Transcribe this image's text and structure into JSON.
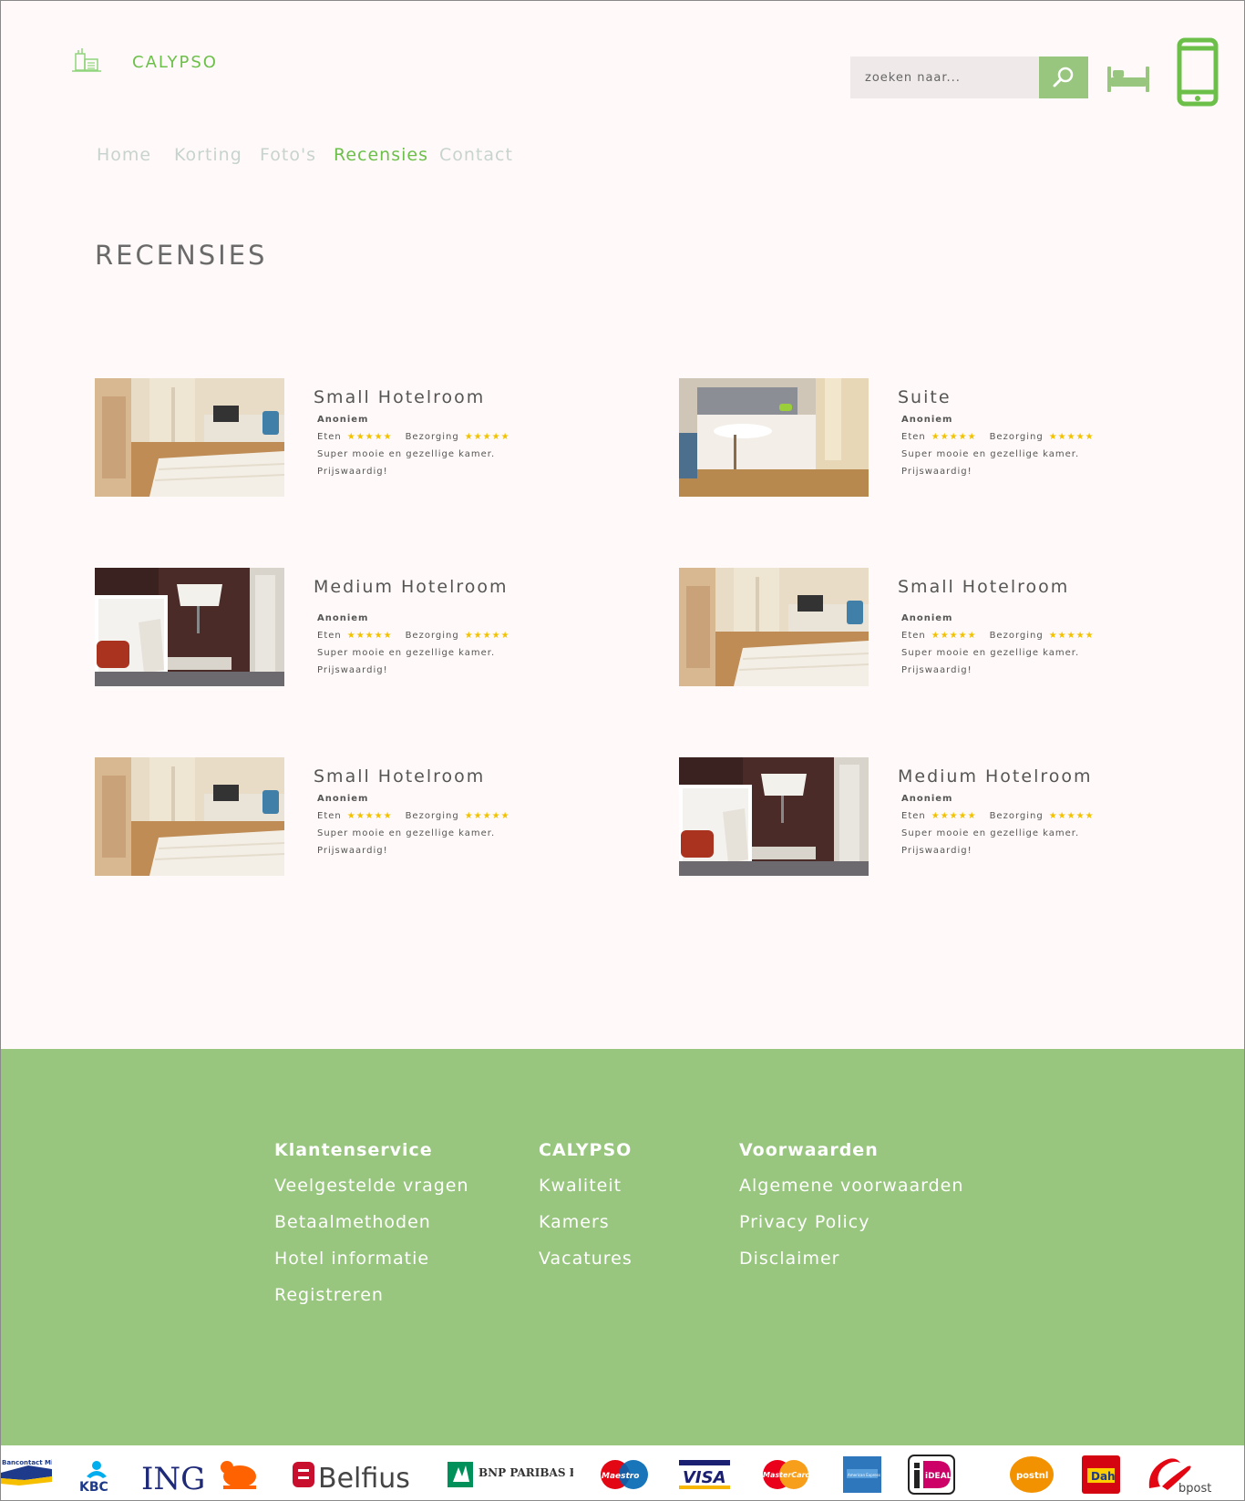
{
  "header": {
    "brand": "CALYPSO",
    "search_placeholder": "zoeken naar..."
  },
  "nav": {
    "items": [
      {
        "label": "Home",
        "active": false
      },
      {
        "label": "Korting",
        "active": false
      },
      {
        "label": "Foto's",
        "active": false
      },
      {
        "label": "Recensies",
        "active": true
      },
      {
        "label": "Contact",
        "active": false
      }
    ]
  },
  "page": {
    "title": "RECENSIES"
  },
  "reviews": [
    {
      "title": "Small Hotelroom",
      "author": "Anoniem",
      "food_label": "Eten",
      "food_stars": "★★★★★",
      "care_label": "Bezorging",
      "care_stars": "★★★★★",
      "comment": "Super mooie en gezellige kamer.",
      "verdict": "Prijswaardig!",
      "image": "hotelroom-bright"
    },
    {
      "title": "Suite",
      "author": "Anoniem",
      "food_label": "Eten",
      "food_stars": "★★★★★",
      "care_label": "Bezorging",
      "care_stars": "★★★★★",
      "comment": "Super mooie en gezellige kamer.",
      "verdict": "Prijswaardig!",
      "image": "suite"
    },
    {
      "title": "Medium Hotelroom",
      "author": "Anoniem",
      "food_label": "Eten",
      "food_stars": "★★★★★",
      "care_label": "Bezorging",
      "care_stars": "★★★★★",
      "comment": "Super mooie en gezellige kamer.",
      "verdict": "Prijswaardig!",
      "image": "hotelroom-dark"
    },
    {
      "title": "Small Hotelroom",
      "author": "Anoniem",
      "food_label": "Eten",
      "food_stars": "★★★★★",
      "care_label": "Bezorging",
      "care_stars": "★★★★★",
      "comment": "Super mooie en gezellige kamer.",
      "verdict": "Prijswaardig!",
      "image": "hotelroom-bright"
    },
    {
      "title": "Small Hotelroom",
      "author": "Anoniem",
      "food_label": "Eten",
      "food_stars": "★★★★★",
      "care_label": "Bezorging",
      "care_stars": "★★★★★",
      "comment": "Super mooie en gezellige kamer.",
      "verdict": "Prijswaardig!",
      "image": "hotelroom-bright"
    },
    {
      "title": "Medium Hotelroom",
      "author": "Anoniem",
      "food_label": "Eten",
      "food_stars": "★★★★★",
      "care_label": "Bezorging",
      "care_stars": "★★★★★",
      "comment": "Super mooie en gezellige kamer.",
      "verdict": "Prijswaardig!",
      "image": "hotelroom-dark"
    }
  ],
  "footer": {
    "columns": [
      {
        "heading": "Klantenservice",
        "links": [
          "Veelgestelde vragen",
          "Betaalmethoden",
          "Hotel informatie",
          "Registreren"
        ]
      },
      {
        "heading": "CALYPSO",
        "links": [
          "Kwaliteit",
          "Kamers",
          "Vacatures"
        ]
      },
      {
        "heading": "Voorwaarden",
        "links": [
          "Algemene voorwaarden",
          "Privacy Policy",
          "Disclaimer"
        ]
      }
    ]
  },
  "payment_logos": {
    "bancontact": "Bancontact Mister Cash",
    "kbc": "KBC",
    "ing": "ING",
    "belfius": "Belfius",
    "bnp": "BNP PARIBAS FORTIS",
    "maestro": "Maestro",
    "visa": "VISA",
    "mastercard": "MasterCard",
    "amex": "American Express",
    "ideal": "iDEAL",
    "postnl": "postnl",
    "dhl": "Dah",
    "bpost": "bpost"
  },
  "colors": {
    "accent": "#6cc04a",
    "footer_bg": "#98c67e",
    "search_bg": "#efe9e9",
    "page_bg": "#fffaf9",
    "nav_inactive": "#c7d3cf",
    "stars": "#f2c200"
  },
  "icons": {
    "logo": "hotel-building-icon",
    "search": "search-icon",
    "bed": "bed-icon",
    "phone": "mobile-phone-icon"
  }
}
